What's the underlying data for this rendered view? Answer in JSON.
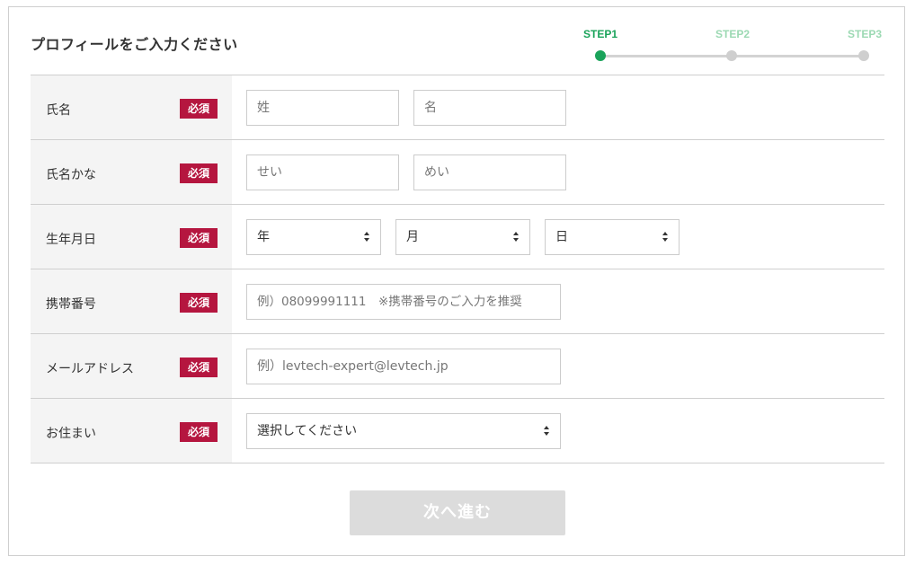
{
  "title": "プロフィールをご入力ください",
  "steps": [
    {
      "label": "STEP1",
      "color": "#1aa35a",
      "active": true
    },
    {
      "label": "STEP2",
      "color": "#9cd9b3",
      "active": false
    },
    {
      "label": "STEP3",
      "color": "#9cd9b3",
      "active": false
    }
  ],
  "required_badge": "必須",
  "fields": {
    "name": {
      "label": "氏名",
      "last_placeholder": "姓",
      "first_placeholder": "名"
    },
    "kana": {
      "label": "氏名かな",
      "last_placeholder": "せい",
      "first_placeholder": "めい"
    },
    "birthday": {
      "label": "生年月日",
      "year": "年",
      "month": "月",
      "day": "日"
    },
    "phone": {
      "label": "携帯番号",
      "placeholder": "例）08099991111　※携帯番号のご入力を推奨"
    },
    "email": {
      "label": "メールアドレス",
      "placeholder": "例）levtech-expert@levtech.jp"
    },
    "residence": {
      "label": "お住まい",
      "selected": "選択してください"
    }
  },
  "submit_label": "次へ進む",
  "colors": {
    "accent": "#1aa35a",
    "required": "#b5163f",
    "disabled": "#dcdcdc"
  }
}
